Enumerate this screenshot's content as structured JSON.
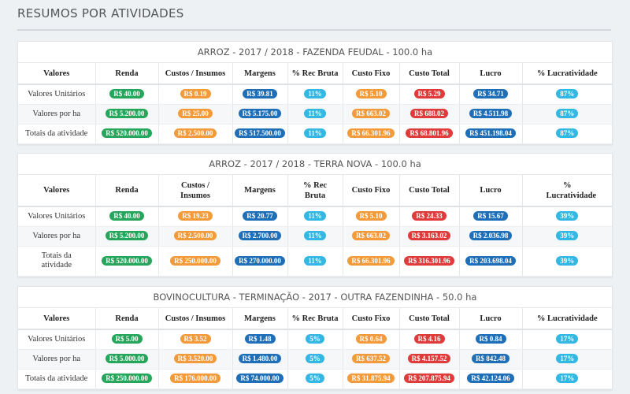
{
  "page": {
    "title": "RESUMOS POR ATIVIDADES"
  },
  "headers": [
    "Valores",
    "Renda",
    "Custos / Insumos",
    "Margens",
    "% Rec Bruta",
    "Custo Fixo",
    "Custo Total",
    "Lucro",
    "% Lucratividade"
  ],
  "colors": {
    "renda": "#26a65b",
    "custos": "#f39a3a",
    "margens": "#1e6fb8",
    "rec_bruta": "#34b8e3",
    "custo_fixo": "#f39a3a",
    "custo_total": "#df3b3b",
    "lucro": "#1e6fb8",
    "lucratividade": "#34b8e3"
  },
  "panels": [
    {
      "title": "ARROZ - 2017 / 2018 - FAZENDA FEUDAL - 100.0 ha",
      "rows": [
        {
          "label": "Valores Unitários",
          "renda": "R$ 40.00",
          "custos": "R$ 0.19",
          "margens": "R$ 39.81",
          "rec_bruta": "11%",
          "custo_fixo": "R$ 5.10",
          "custo_total": "R$ 5.29",
          "lucro": "R$ 34.71",
          "lucratividade": "87%"
        },
        {
          "label": "Valores por ha",
          "renda": "R$ 5.200.00",
          "custos": "R$ 25.00",
          "margens": "R$ 5.175.00",
          "rec_bruta": "11%",
          "custo_fixo": "R$ 663.02",
          "custo_total": "R$ 688.02",
          "lucro": "R$ 4.511.98",
          "lucratividade": "87%"
        },
        {
          "label": "Totais da atividade",
          "renda": "R$ 520.000.00",
          "custos": "R$ 2.500.00",
          "margens": "R$ 517.500.00",
          "rec_bruta": "11%",
          "custo_fixo": "R$ 66.301.96",
          "custo_total": "R$ 68.801.96",
          "lucro": "R$ 451.198.04",
          "lucratividade": "87%"
        }
      ]
    },
    {
      "title": "ARROZ - 2017 / 2018 - TERRA NOVA - 100.0 ha",
      "rows": [
        {
          "label": "Valores Unitários",
          "renda": "R$ 40.00",
          "custos": "R$ 19.23",
          "margens": "R$ 20.77",
          "rec_bruta": "11%",
          "custo_fixo": "R$ 5.10",
          "custo_total": "R$ 24.33",
          "lucro": "R$ 15.67",
          "lucratividade": "39%"
        },
        {
          "label": "Valores por ha",
          "renda": "R$ 5.200.00",
          "custos": "R$ 2.500.00",
          "margens": "R$ 2.700.00",
          "rec_bruta": "11%",
          "custo_fixo": "R$ 663.02",
          "custo_total": "R$ 3.163.02",
          "lucro": "R$ 2.036.98",
          "lucratividade": "39%"
        },
        {
          "label": "Totais da atividade",
          "renda": "R$ 520.000.00",
          "custos": "R$ 250.000.00",
          "margens": "R$ 270.000.00",
          "rec_bruta": "11%",
          "custo_fixo": "R$ 66.301.96",
          "custo_total": "R$ 316.301.96",
          "lucro": "R$ 203.698.04",
          "lucratividade": "39%"
        }
      ]
    },
    {
      "title": "BOVINOCULTURA - TERMINAÇÃO - 2017 - OUTRA FAZENDINHA - 50.0 ha",
      "rows": [
        {
          "label": "Valores Unitários",
          "renda": "R$ 5.00",
          "custos": "R$ 3.52",
          "margens": "R$ 1.48",
          "rec_bruta": "5%",
          "custo_fixo": "R$ 0.64",
          "custo_total": "R$ 4.16",
          "lucro": "R$ 0.84",
          "lucratividade": "17%"
        },
        {
          "label": "Valores por ha",
          "renda": "R$ 5.000.00",
          "custos": "R$ 3.520.00",
          "margens": "R$ 1.480.00",
          "rec_bruta": "5%",
          "custo_fixo": "R$ 637.52",
          "custo_total": "R$ 4.157.52",
          "lucro": "R$ 842.48",
          "lucratividade": "17%"
        },
        {
          "label": "Totais da atividade",
          "renda": "R$ 250.000.00",
          "custos": "R$ 176.000.00",
          "margens": "R$ 74.000.00",
          "rec_bruta": "5%",
          "custo_fixo": "R$ 31.875.94",
          "custo_total": "R$ 207.875.94",
          "lucro": "R$ 42.124.06",
          "lucratividade": "17%"
        }
      ]
    }
  ]
}
